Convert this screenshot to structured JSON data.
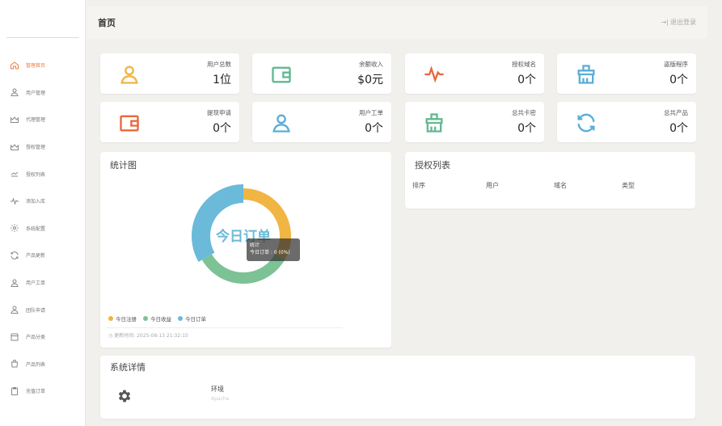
{
  "header": {
    "title": "首页",
    "logout": "退出登录"
  },
  "sidebar": {
    "items": [
      {
        "label": "管理首页",
        "icon": "home-icon",
        "active": true
      },
      {
        "label": "用户管理",
        "icon": "user-icon"
      },
      {
        "label": "代理管理",
        "icon": "crown-icon"
      },
      {
        "label": "授权管理",
        "icon": "crown-icon"
      },
      {
        "label": "授权列表",
        "icon": "list-icon"
      },
      {
        "label": "添加入库",
        "icon": "pulse-icon"
      },
      {
        "label": "系统配置",
        "icon": "gear-icon"
      },
      {
        "label": "产品更新",
        "icon": "refresh-icon"
      },
      {
        "label": "用户工单",
        "icon": "user-icon"
      },
      {
        "label": "团队申请",
        "icon": "user-icon"
      },
      {
        "label": "产品分类",
        "icon": "shop-icon"
      },
      {
        "label": "产品列表",
        "icon": "bag-icon"
      },
      {
        "label": "充值订单",
        "icon": "clipboard-icon"
      }
    ]
  },
  "stats": [
    {
      "label": "用户总数",
      "value": "1位",
      "icon": "user-icon",
      "color": "#f0b543"
    },
    {
      "label": "余额收入",
      "value": "$0元",
      "icon": "wallet-icon",
      "color": "#63b891"
    },
    {
      "label": "授权域名",
      "value": "0个",
      "icon": "pulse-icon",
      "color": "#e9683f"
    },
    {
      "label": "盗版程序",
      "value": "0个",
      "icon": "brush-icon",
      "color": "#5aaed6"
    },
    {
      "label": "提现申请",
      "value": "0个",
      "icon": "wallet-icon",
      "color": "#e9683f"
    },
    {
      "label": "用户工单",
      "value": "0个",
      "icon": "user-icon",
      "color": "#5aaed6"
    },
    {
      "label": "总共卡密",
      "value": "0个",
      "icon": "brush-icon",
      "color": "#63b891"
    },
    {
      "label": "总共产品",
      "value": "0个",
      "icon": "refresh-icon",
      "color": "#5aaed6"
    }
  ],
  "chart_panel": {
    "title": "统计图",
    "center_label": "今日订单",
    "tooltip_title": "统计",
    "tooltip_line": "今日订单 : 0 (0%)",
    "updated": "更新时间:  2025-08-13 21:32:15"
  },
  "chart_data": {
    "type": "pie",
    "categories": [
      "今日注册",
      "今日收益",
      "今日订单"
    ],
    "values": [
      0,
      0,
      0
    ],
    "colors": [
      "#f0b543",
      "#7cc295",
      "#6bbad9"
    ],
    "legend": "bottom-left"
  },
  "auth": {
    "title": "授权列表",
    "columns": [
      "排序",
      "用户",
      "域名",
      "类型"
    ]
  },
  "sys": {
    "title": "系统详情",
    "env_label": "环境",
    "env_value": "Apache"
  }
}
